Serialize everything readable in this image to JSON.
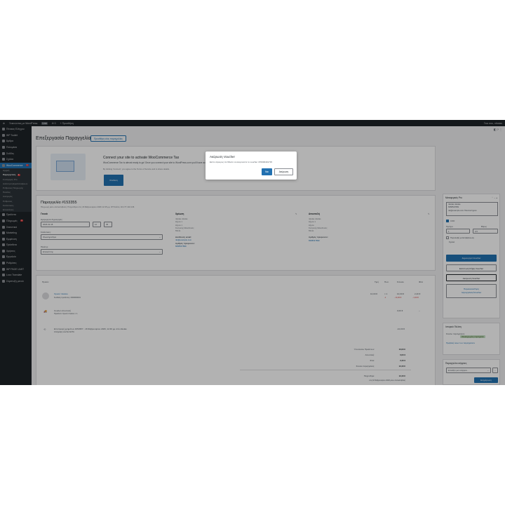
{
  "adminbar": {
    "site": "Ξεκινώντας με WordPress",
    "live": "Live",
    "comments": "0",
    "new": "Προσθήκη",
    "user": "Γεια σου, nikolas"
  },
  "sidebar": {
    "items": [
      {
        "label": "Πίνακας Ελέγχου"
      },
      {
        "label": "WP Toolkit"
      },
      {
        "label": "Άρθρα"
      },
      {
        "label": "Πολυμέσα"
      },
      {
        "label": "Σελίδες"
      },
      {
        "label": "Σχόλια"
      },
      {
        "label": "WooCommerce",
        "badge": "1"
      }
    ],
    "subitems": [
      {
        "label": "Αρχική"
      },
      {
        "label": "Παραγγελίες",
        "badge": "1",
        "current": true
      },
      {
        "label": "Συνδρομές Pro"
      },
      {
        "label": "Ανάκτηση Εγκαταλείψεων"
      },
      {
        "label": "Ρυθμίσεις Πληρωμής"
      },
      {
        "label": "Πελάτες"
      },
      {
        "label": "Αναφορές"
      },
      {
        "label": "Ρυθμίσεις"
      },
      {
        "label": "Κατάσταση"
      },
      {
        "label": "Επεκτάσεις"
      }
    ],
    "items2": [
      {
        "label": "Προϊόντα"
      },
      {
        "label": "Πληρωμές",
        "badge": "1"
      },
      {
        "label": "Στατιστικά"
      },
      {
        "label": "Marketing"
      },
      {
        "label": "Εμφάνιση"
      },
      {
        "label": "Πρόσθετα"
      },
      {
        "label": "Χρήστες"
      },
      {
        "label": "Εργαλεία"
      },
      {
        "label": "Ρυθμίσεις"
      },
      {
        "label": "WP PAGE LIMIT"
      },
      {
        "label": "Loco Translate"
      },
      {
        "label": "Σύμπτυξη μενού"
      }
    ]
  },
  "page": {
    "title": "Επεξεργασία Παραγγελίας",
    "add_new": "Προσθήκη νέας παραγγελίας"
  },
  "promo": {
    "heading": "Connect your site to activate WooCommerce Tax",
    "text": "WooCommerce Tax is almost ready to go! Once you connect your site to WordPress.com you'll have access to automated tax calculations.",
    "note": "By clicking 'Connect', you agree to the Terms of Service and to share details.",
    "cta": "Σύνδεση"
  },
  "order": {
    "title": "Παραγγελία #153355",
    "subtitle": "Πληρωμή μέσω Αντικαταβολή. Πληρώθηκε στις 18 Φεβρουαρίου 2026 12:45 μμ. IP Πελάτη: 46.177.102.136",
    "general": "Γενικά",
    "date_label": "Ημερομηνία δημιουργίας:",
    "date": "2026-02-18",
    "hour": "12",
    "minute": "45",
    "status_label": "Κατάσταση:",
    "status": "Ολοκληρώθηκε",
    "customer_label": "Πελάτης:",
    "customer": "Επισκέπτης",
    "billing": "Χρέωση",
    "billing_lines": [
      "nikolas nikolas",
      "Δήμου 1",
      "Δήμου 1",
      "Κεντρικής Μακεδονίας",
      "55131"
    ],
    "email_label": "Διεύθυνση email:",
    "email": "nik@example.com",
    "phone_label": "Αριθμός τηλεφώνου:",
    "phone": "6958547899",
    "shipping": "Αποστολή",
    "shipping_lines": [
      "nikolas nikolas",
      "Δήμου 1",
      "Δήμου",
      "Κεντρικής Μακεδονίας",
      "55131"
    ],
    "ship_phone_label": "Αριθμός τηλεφώνου:",
    "ship_phone": "6958547899"
  },
  "items": {
    "head": {
      "item": "Προϊόν",
      "cost": "Τιμή",
      "qty": "Ποσ.",
      "total": "Σύνολο",
      "tax": "Φπα"
    },
    "product": {
      "name": "Χρυσό πλαίσιο",
      "sku": "Κωδικός προϊόντος: 0000000001",
      "cost": "10,00 €",
      "qty": "× 1",
      "total": "10,00 €",
      "tax": "2,40 €",
      "refund": "-1",
      "refund_total": "- 14,00 €",
      "refund_tax": "- 2,40 €"
    },
    "shipping": {
      "name": "Courier αποστολή",
      "meta": "Προϊόντα: Χρυσό πλαίσιο × 1",
      "total": "0,00 €",
      "tax": "–"
    },
    "refund": {
      "name": "Επιστροφή χρημάτων #153357 - 18 Φεβρουαρίου 2026, 12:46 μμ από nikolas",
      "reason": "Απόρριψη voucher ΕΛΤΑ",
      "total": "-10,00 €"
    }
  },
  "totals": {
    "subtotal_label": "Υποσύνολο Προϊόντων:",
    "subtotal": "10,00 €",
    "shipping_label": "Αποστολή:",
    "shipping": "0,00 €",
    "tax_label": "Φπα:",
    "tax": "2,40 €",
    "order_total_label": "Σύνολο παραγγελίας:",
    "order_total": "12,40 €",
    "paid_label": "Πληρώθηκε:",
    "paid": "12,40 €",
    "paid_note": "στις 18 Φεβρουαρίου 2026 μέσω Αντικαταβολή"
  },
  "voucher_box": {
    "title": "Μεταφορικές Pro",
    "lines": [
      "nikolas nikolas",
      "6958547899",
      "nik@example.com Πανεπιστημίου"
    ],
    "cod_label": "COD",
    "weight_label": "Βάρος",
    "weight": "0,5",
    "pieces_label": "Τεμάχια",
    "pieces": "1",
    "return_label": "Παραλαβή με Επιβεβαίωση",
    "notes_label": "Σχόλια",
    "create": "Δημιουργία Voucher",
    "print": "Εκτύπωση/Λήψη Voucher",
    "cancel": "Ακύρωση Voucher",
    "track_1": "Παρακολούθηση",
    "track_2": "παραγγελίας/Voucher"
  },
  "customer_history": {
    "title": "Ιστορικό Πελάτη",
    "orders_label": "Σύνολο παραγγελιών:",
    "status": "Ολοκληρωμένη παραγγελία",
    "link": "Προβολή όλων των παραγγελιών"
  },
  "order_actions": {
    "title": "Παραγγελία ενέργειες",
    "select": "Επιλέξτε μια ενέργεια...",
    "go": "›",
    "update": "Ενημέρωση"
  },
  "modal": {
    "title": "Ακύρωση Voucher",
    "text": "Είστε σίγουρος ότι θέλετε να ακυρώσετε το voucher 470000401715",
    "yes": "Ναι",
    "cancel": "Ακύρωση"
  },
  "colors": {
    "primary": "#2271b1",
    "adminbar": "#1d2327",
    "overlay": "rgba(0,0,0,0.3)"
  }
}
